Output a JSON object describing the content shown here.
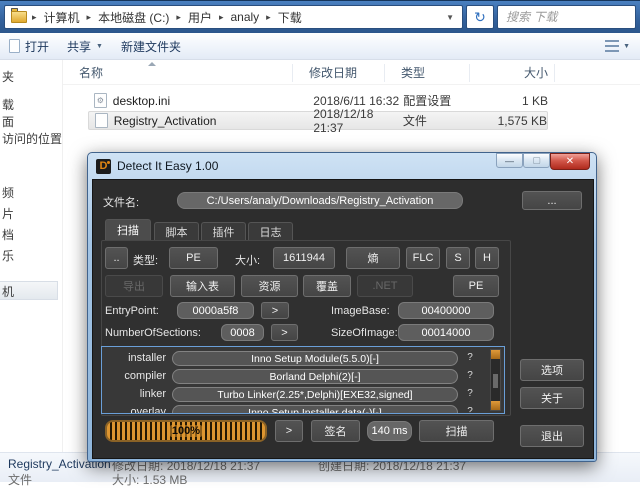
{
  "icons": {
    "dropdown": "▼",
    "crumb_sep": "▸",
    "refresh": "↻",
    "minimize": "—",
    "maximize": "▢",
    "close": "✕",
    "gear": "⚙"
  },
  "explorer": {
    "breadcrumbs": [
      "计算机",
      "本地磁盘 (C:)",
      "用户",
      "analy",
      "下载"
    ],
    "search_placeholder": "搜索 下载",
    "toolbar": {
      "open": "打开",
      "share": "共享",
      "new_folder": "新建文件夹"
    },
    "sidebar_fragments": {
      "f0": "夹",
      "f1": "载",
      "f2": "面",
      "f3": "访问的位置",
      "f4": "频",
      "f5": "片",
      "f6": "档",
      "f7": "乐",
      "f8": "机"
    },
    "columns": {
      "name": "名称",
      "date": "修改日期",
      "type": "类型",
      "size": "大小"
    },
    "files": [
      {
        "name": "desktop.ini",
        "date": "2018/6/11 16:32",
        "type": "配置设置",
        "size": "1 KB"
      },
      {
        "name": "Registry_Activation",
        "date": "2018/12/18 21:37",
        "type": "文件",
        "size": "1,575 KB"
      }
    ],
    "status": {
      "file_name": "Registry_Activation",
      "modified_label": "修改日期:",
      "modified": "2018/12/18 21:37",
      "created_label": "创建日期:",
      "created": "2018/12/18 21:37",
      "file_type": "文件",
      "size_label": "大小:",
      "size_value": "1.53 MB"
    }
  },
  "die": {
    "title": "Detect It Easy 1.00",
    "filename_label": "文件名:",
    "filename": "C:/Users/analy/Downloads/Registry_Activation",
    "browse": "...",
    "tabs": {
      "scan": "扫描",
      "script": "脚本",
      "plugin": "插件",
      "log": "日志"
    },
    "dots": "..",
    "type_label": "类型:",
    "type_value": "PE",
    "size_label": "大小:",
    "size_value": "1611944",
    "entropy": "熵",
    "flc": "FLC",
    "s": "S",
    "h": "H",
    "export": "导出",
    "imports": "输入表",
    "resources": "资源",
    "overlay_btn": "覆盖",
    "dotnet": ".NET",
    "pe": "PE",
    "entrypoint_label": "EntryPoint:",
    "entrypoint": "0000a5f8",
    "imagebase_label": "ImageBase:",
    "imagebase": "00400000",
    "sections_label": "NumberOfSections:",
    "sections": "0008",
    "sizeofimage_label": "SizeOfImage:",
    "sizeofimage": "00014000",
    "arrow": ">",
    "detections": [
      {
        "kind": "installer",
        "value": "Inno Setup Module(5.5.0)[-]",
        "more": "?"
      },
      {
        "kind": "compiler",
        "value": "Borland Delphi(2)[-]",
        "more": "?"
      },
      {
        "kind": "linker",
        "value": "Turbo Linker(2.25*,Delphi)[EXE32,signed]",
        "more": "?"
      },
      {
        "kind": "overlay",
        "value": "Inno Setup Installer data(-)[-]",
        "more": "?"
      }
    ],
    "progress": "100%",
    "signature": "签名",
    "scan_time": "140 ms",
    "scan": "扫描",
    "options": "选项",
    "about": "关于",
    "exit": "退出"
  },
  "colors": {
    "accent_orange": "#dd9530",
    "aero_blue": "#33619c",
    "dialog_bg": "#2d2d2d"
  }
}
